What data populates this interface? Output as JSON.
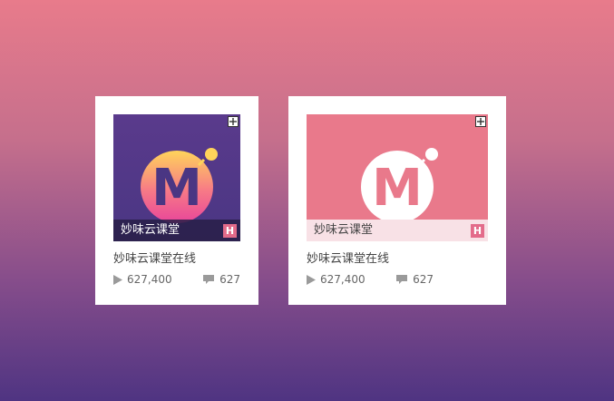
{
  "cards": [
    {
      "caption": "妙味云课堂",
      "badge": "H",
      "logo_letter": "M",
      "title": "妙味云课堂在线",
      "plays": "627,400",
      "comments": "627",
      "thumb_style": "purple-gradient"
    },
    {
      "caption": "妙味云课堂",
      "badge": "H",
      "logo_letter": "M",
      "title": "妙味云课堂在线",
      "plays": "627,400",
      "comments": "627",
      "thumb_style": "pink"
    }
  ],
  "colors": {
    "accent_pink": "#e9798b",
    "badge_pink": "#e36b8a",
    "card_bg": "#ffffff",
    "purple": "#4a3683"
  },
  "icons": {
    "add": "add-icon",
    "play": "play-icon",
    "comment": "comment-icon",
    "badge": "hot-badge"
  }
}
